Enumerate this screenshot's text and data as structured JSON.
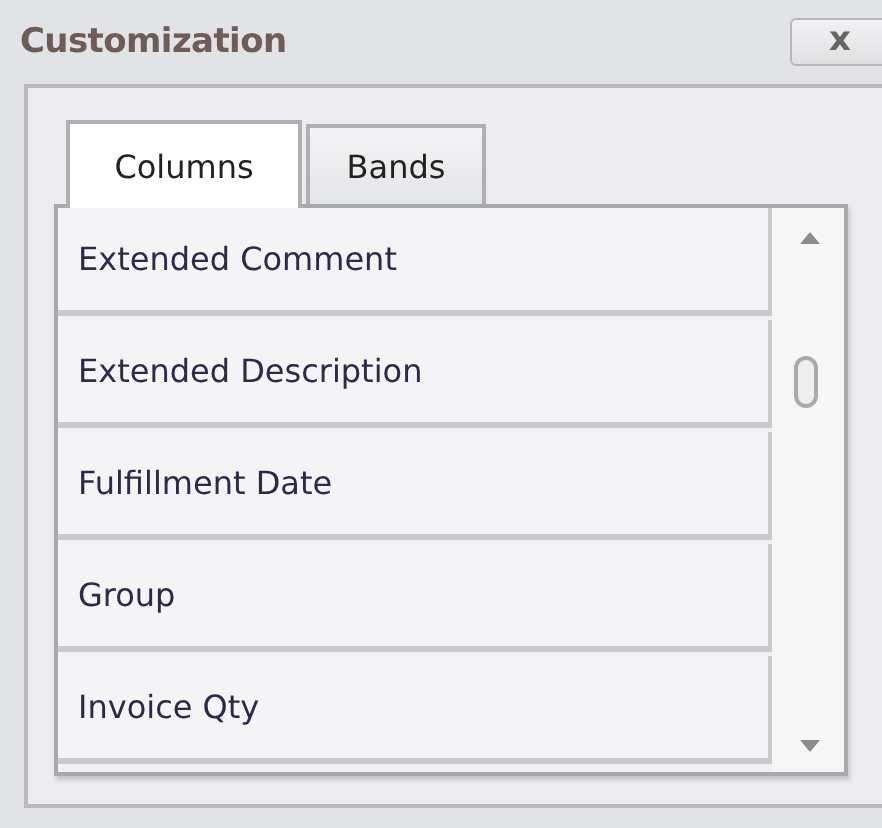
{
  "window": {
    "title": "Customization",
    "close": "x"
  },
  "tabs": [
    {
      "label": "Columns",
      "selected": true
    },
    {
      "label": "Bands",
      "selected": false
    }
  ],
  "list": {
    "items": [
      {
        "label": "Extended Comment"
      },
      {
        "label": "Extended Description"
      },
      {
        "label": "Fulfillment Date"
      },
      {
        "label": "Group"
      },
      {
        "label": "Invoice Qty"
      }
    ]
  }
}
